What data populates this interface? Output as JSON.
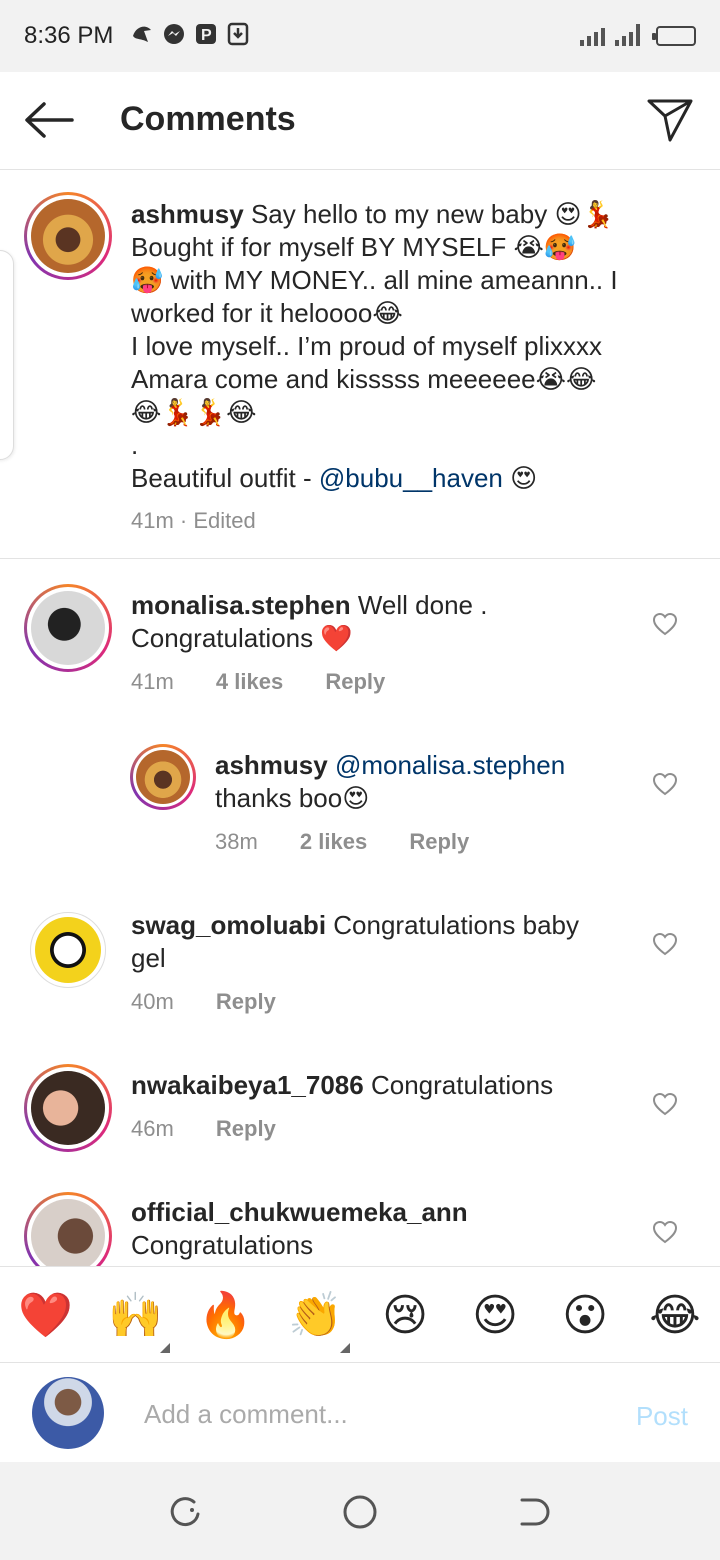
{
  "status_bar": {
    "time": "8:36 PM",
    "notification_icons": [
      "app-icon",
      "messenger-icon",
      "p-icon",
      "download-icon"
    ]
  },
  "header": {
    "title": "Comments"
  },
  "post": {
    "username": "ashmusy",
    "caption_lines": [
      " Say hello to my new baby 😍💃",
      "Bought if for myself BY MYSELF 😭🥵",
      "🥵 with MY MONEY.. all mine ameannn.. I",
      "worked for it heloooo😂",
      "I love myself.. I’m proud of myself  plixxxx",
      "Amara come and kisssss meeeeee😭😂",
      "😂💃💃😂",
      "."
    ],
    "outfit_prefix": "Beautiful outfit - ",
    "outfit_mention": "@bubu__haven",
    "outfit_suffix": " 😍",
    "time": "41m",
    "edited": " · Edited"
  },
  "comments": [
    {
      "username": "monalisa.stephen",
      "text_line1": " Well done .",
      "text_line2": "Congratulations ❤️",
      "time": "41m",
      "likes": "4 likes",
      "reply": "Reply"
    },
    {
      "username": "ashmusy",
      "mention": " @monalisa.stephen",
      "text_line2": "thanks boo😍",
      "time": "38m",
      "likes": "2 likes",
      "reply": "Reply"
    },
    {
      "username": "swag_omoluabi",
      "text_line1": " Congratulations baby",
      "text_line2": "gel",
      "time": "40m",
      "reply": "Reply"
    },
    {
      "username": "nwakaibeya1_7086",
      "text_line1": " Congratulations",
      "time": "46m",
      "reply": "Reply"
    },
    {
      "username": "official_chukwuemeka_ann",
      "text_line2": "Congratulations"
    }
  ],
  "quick_emojis": [
    "❤️",
    "🙌",
    "🔥",
    "👏",
    "😢",
    "😍",
    "😮",
    "😂"
  ],
  "composer": {
    "placeholder": "Add a comment...",
    "post_label": "Post"
  }
}
